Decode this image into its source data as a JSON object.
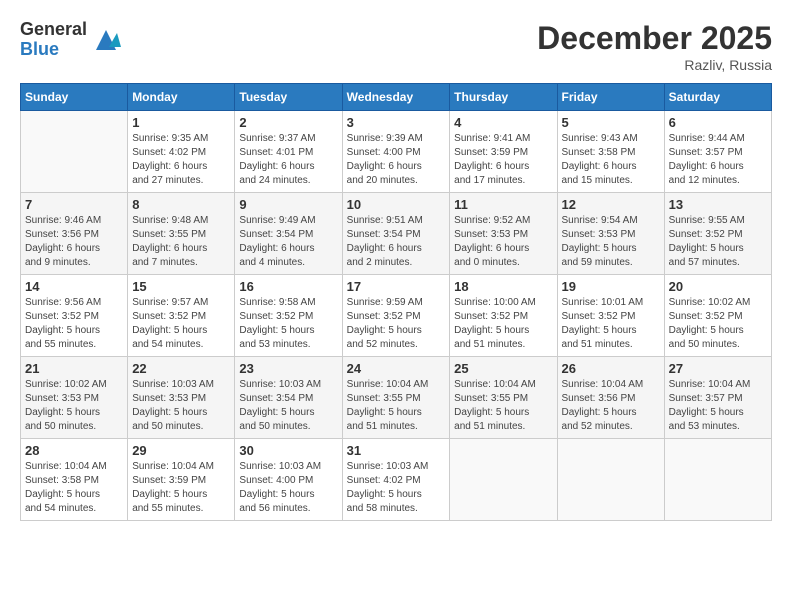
{
  "header": {
    "logo_general": "General",
    "logo_blue": "Blue",
    "month_title": "December 2025",
    "location": "Razliv, Russia"
  },
  "days_of_week": [
    "Sunday",
    "Monday",
    "Tuesday",
    "Wednesday",
    "Thursday",
    "Friday",
    "Saturday"
  ],
  "weeks": [
    [
      {
        "day": "",
        "info": ""
      },
      {
        "day": "1",
        "info": "Sunrise: 9:35 AM\nSunset: 4:02 PM\nDaylight: 6 hours\nand 27 minutes."
      },
      {
        "day": "2",
        "info": "Sunrise: 9:37 AM\nSunset: 4:01 PM\nDaylight: 6 hours\nand 24 minutes."
      },
      {
        "day": "3",
        "info": "Sunrise: 9:39 AM\nSunset: 4:00 PM\nDaylight: 6 hours\nand 20 minutes."
      },
      {
        "day": "4",
        "info": "Sunrise: 9:41 AM\nSunset: 3:59 PM\nDaylight: 6 hours\nand 17 minutes."
      },
      {
        "day": "5",
        "info": "Sunrise: 9:43 AM\nSunset: 3:58 PM\nDaylight: 6 hours\nand 15 minutes."
      },
      {
        "day": "6",
        "info": "Sunrise: 9:44 AM\nSunset: 3:57 PM\nDaylight: 6 hours\nand 12 minutes."
      }
    ],
    [
      {
        "day": "7",
        "info": "Sunrise: 9:46 AM\nSunset: 3:56 PM\nDaylight: 6 hours\nand 9 minutes."
      },
      {
        "day": "8",
        "info": "Sunrise: 9:48 AM\nSunset: 3:55 PM\nDaylight: 6 hours\nand 7 minutes."
      },
      {
        "day": "9",
        "info": "Sunrise: 9:49 AM\nSunset: 3:54 PM\nDaylight: 6 hours\nand 4 minutes."
      },
      {
        "day": "10",
        "info": "Sunrise: 9:51 AM\nSunset: 3:54 PM\nDaylight: 6 hours\nand 2 minutes."
      },
      {
        "day": "11",
        "info": "Sunrise: 9:52 AM\nSunset: 3:53 PM\nDaylight: 6 hours\nand 0 minutes."
      },
      {
        "day": "12",
        "info": "Sunrise: 9:54 AM\nSunset: 3:53 PM\nDaylight: 5 hours\nand 59 minutes."
      },
      {
        "day": "13",
        "info": "Sunrise: 9:55 AM\nSunset: 3:52 PM\nDaylight: 5 hours\nand 57 minutes."
      }
    ],
    [
      {
        "day": "14",
        "info": "Sunrise: 9:56 AM\nSunset: 3:52 PM\nDaylight: 5 hours\nand 55 minutes."
      },
      {
        "day": "15",
        "info": "Sunrise: 9:57 AM\nSunset: 3:52 PM\nDaylight: 5 hours\nand 54 minutes."
      },
      {
        "day": "16",
        "info": "Sunrise: 9:58 AM\nSunset: 3:52 PM\nDaylight: 5 hours\nand 53 minutes."
      },
      {
        "day": "17",
        "info": "Sunrise: 9:59 AM\nSunset: 3:52 PM\nDaylight: 5 hours\nand 52 minutes."
      },
      {
        "day": "18",
        "info": "Sunrise: 10:00 AM\nSunset: 3:52 PM\nDaylight: 5 hours\nand 51 minutes."
      },
      {
        "day": "19",
        "info": "Sunrise: 10:01 AM\nSunset: 3:52 PM\nDaylight: 5 hours\nand 51 minutes."
      },
      {
        "day": "20",
        "info": "Sunrise: 10:02 AM\nSunset: 3:52 PM\nDaylight: 5 hours\nand 50 minutes."
      }
    ],
    [
      {
        "day": "21",
        "info": "Sunrise: 10:02 AM\nSunset: 3:53 PM\nDaylight: 5 hours\nand 50 minutes."
      },
      {
        "day": "22",
        "info": "Sunrise: 10:03 AM\nSunset: 3:53 PM\nDaylight: 5 hours\nand 50 minutes."
      },
      {
        "day": "23",
        "info": "Sunrise: 10:03 AM\nSunset: 3:54 PM\nDaylight: 5 hours\nand 50 minutes."
      },
      {
        "day": "24",
        "info": "Sunrise: 10:04 AM\nSunset: 3:55 PM\nDaylight: 5 hours\nand 51 minutes."
      },
      {
        "day": "25",
        "info": "Sunrise: 10:04 AM\nSunset: 3:55 PM\nDaylight: 5 hours\nand 51 minutes."
      },
      {
        "day": "26",
        "info": "Sunrise: 10:04 AM\nSunset: 3:56 PM\nDaylight: 5 hours\nand 52 minutes."
      },
      {
        "day": "27",
        "info": "Sunrise: 10:04 AM\nSunset: 3:57 PM\nDaylight: 5 hours\nand 53 minutes."
      }
    ],
    [
      {
        "day": "28",
        "info": "Sunrise: 10:04 AM\nSunset: 3:58 PM\nDaylight: 5 hours\nand 54 minutes."
      },
      {
        "day": "29",
        "info": "Sunrise: 10:04 AM\nSunset: 3:59 PM\nDaylight: 5 hours\nand 55 minutes."
      },
      {
        "day": "30",
        "info": "Sunrise: 10:03 AM\nSunset: 4:00 PM\nDaylight: 5 hours\nand 56 minutes."
      },
      {
        "day": "31",
        "info": "Sunrise: 10:03 AM\nSunset: 4:02 PM\nDaylight: 5 hours\nand 58 minutes."
      },
      {
        "day": "",
        "info": ""
      },
      {
        "day": "",
        "info": ""
      },
      {
        "day": "",
        "info": ""
      }
    ]
  ]
}
